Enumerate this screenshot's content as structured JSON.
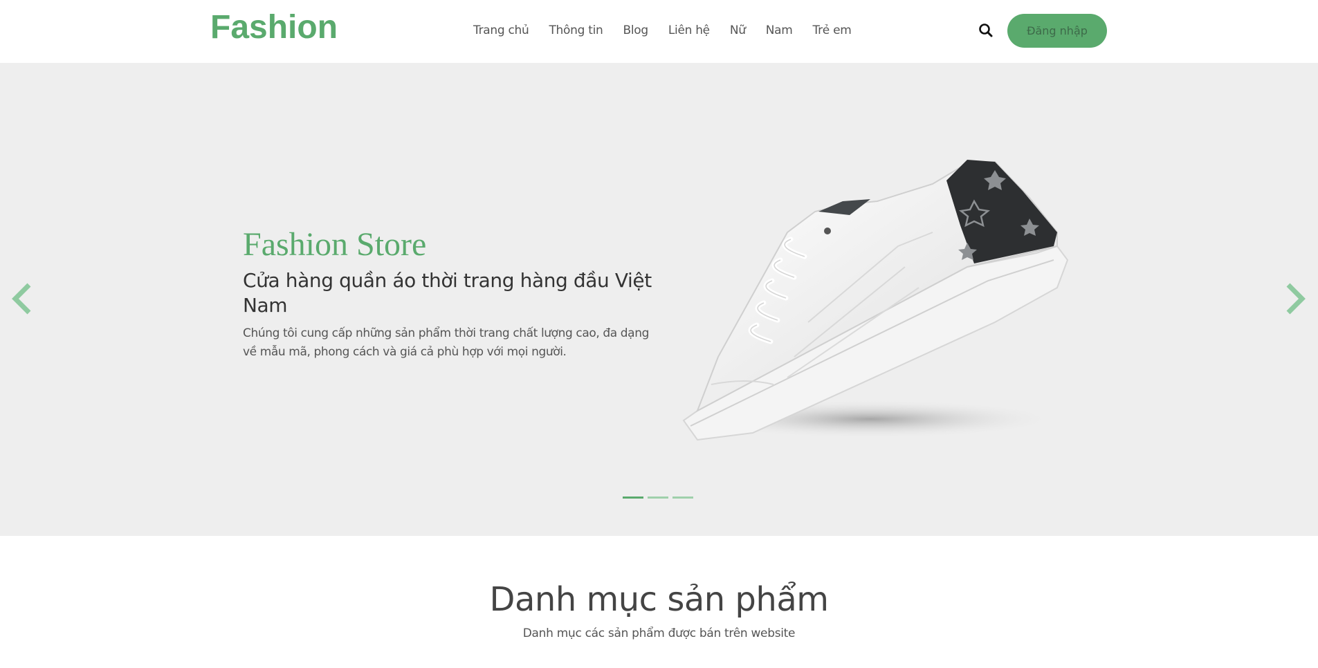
{
  "header": {
    "logo": "Fashion",
    "nav": [
      "Trang chủ",
      "Thông tin",
      "Blog",
      "Liên hệ",
      "Nữ",
      "Nam",
      "Trẻ em"
    ],
    "search_icon": "search-icon",
    "login_label": "Đăng nhập"
  },
  "hero": {
    "title": "Fashion Store",
    "subtitle": "Cửa hàng quần áo thời trang hàng đầu Việt Nam",
    "description": "Chúng tôi cung cấp những sản phẩm thời trang chất lượng cao, đa dạng về mẫu mã, phong cách và giá cả phù hợp với mọi người.",
    "image": "sneaker-image",
    "slides_total": 3,
    "active_slide": 1,
    "prev_icon": "chevron-left-icon",
    "next_icon": "chevron-right-icon"
  },
  "categories": {
    "title": "Danh mục sản phẩm",
    "subtitle": "Danh mục các sản phẩm được bán trên website"
  },
  "colors": {
    "accent": "#5aaa6d",
    "accent_light": "#9fd0ab",
    "hero_bg": "#eeeeee"
  }
}
